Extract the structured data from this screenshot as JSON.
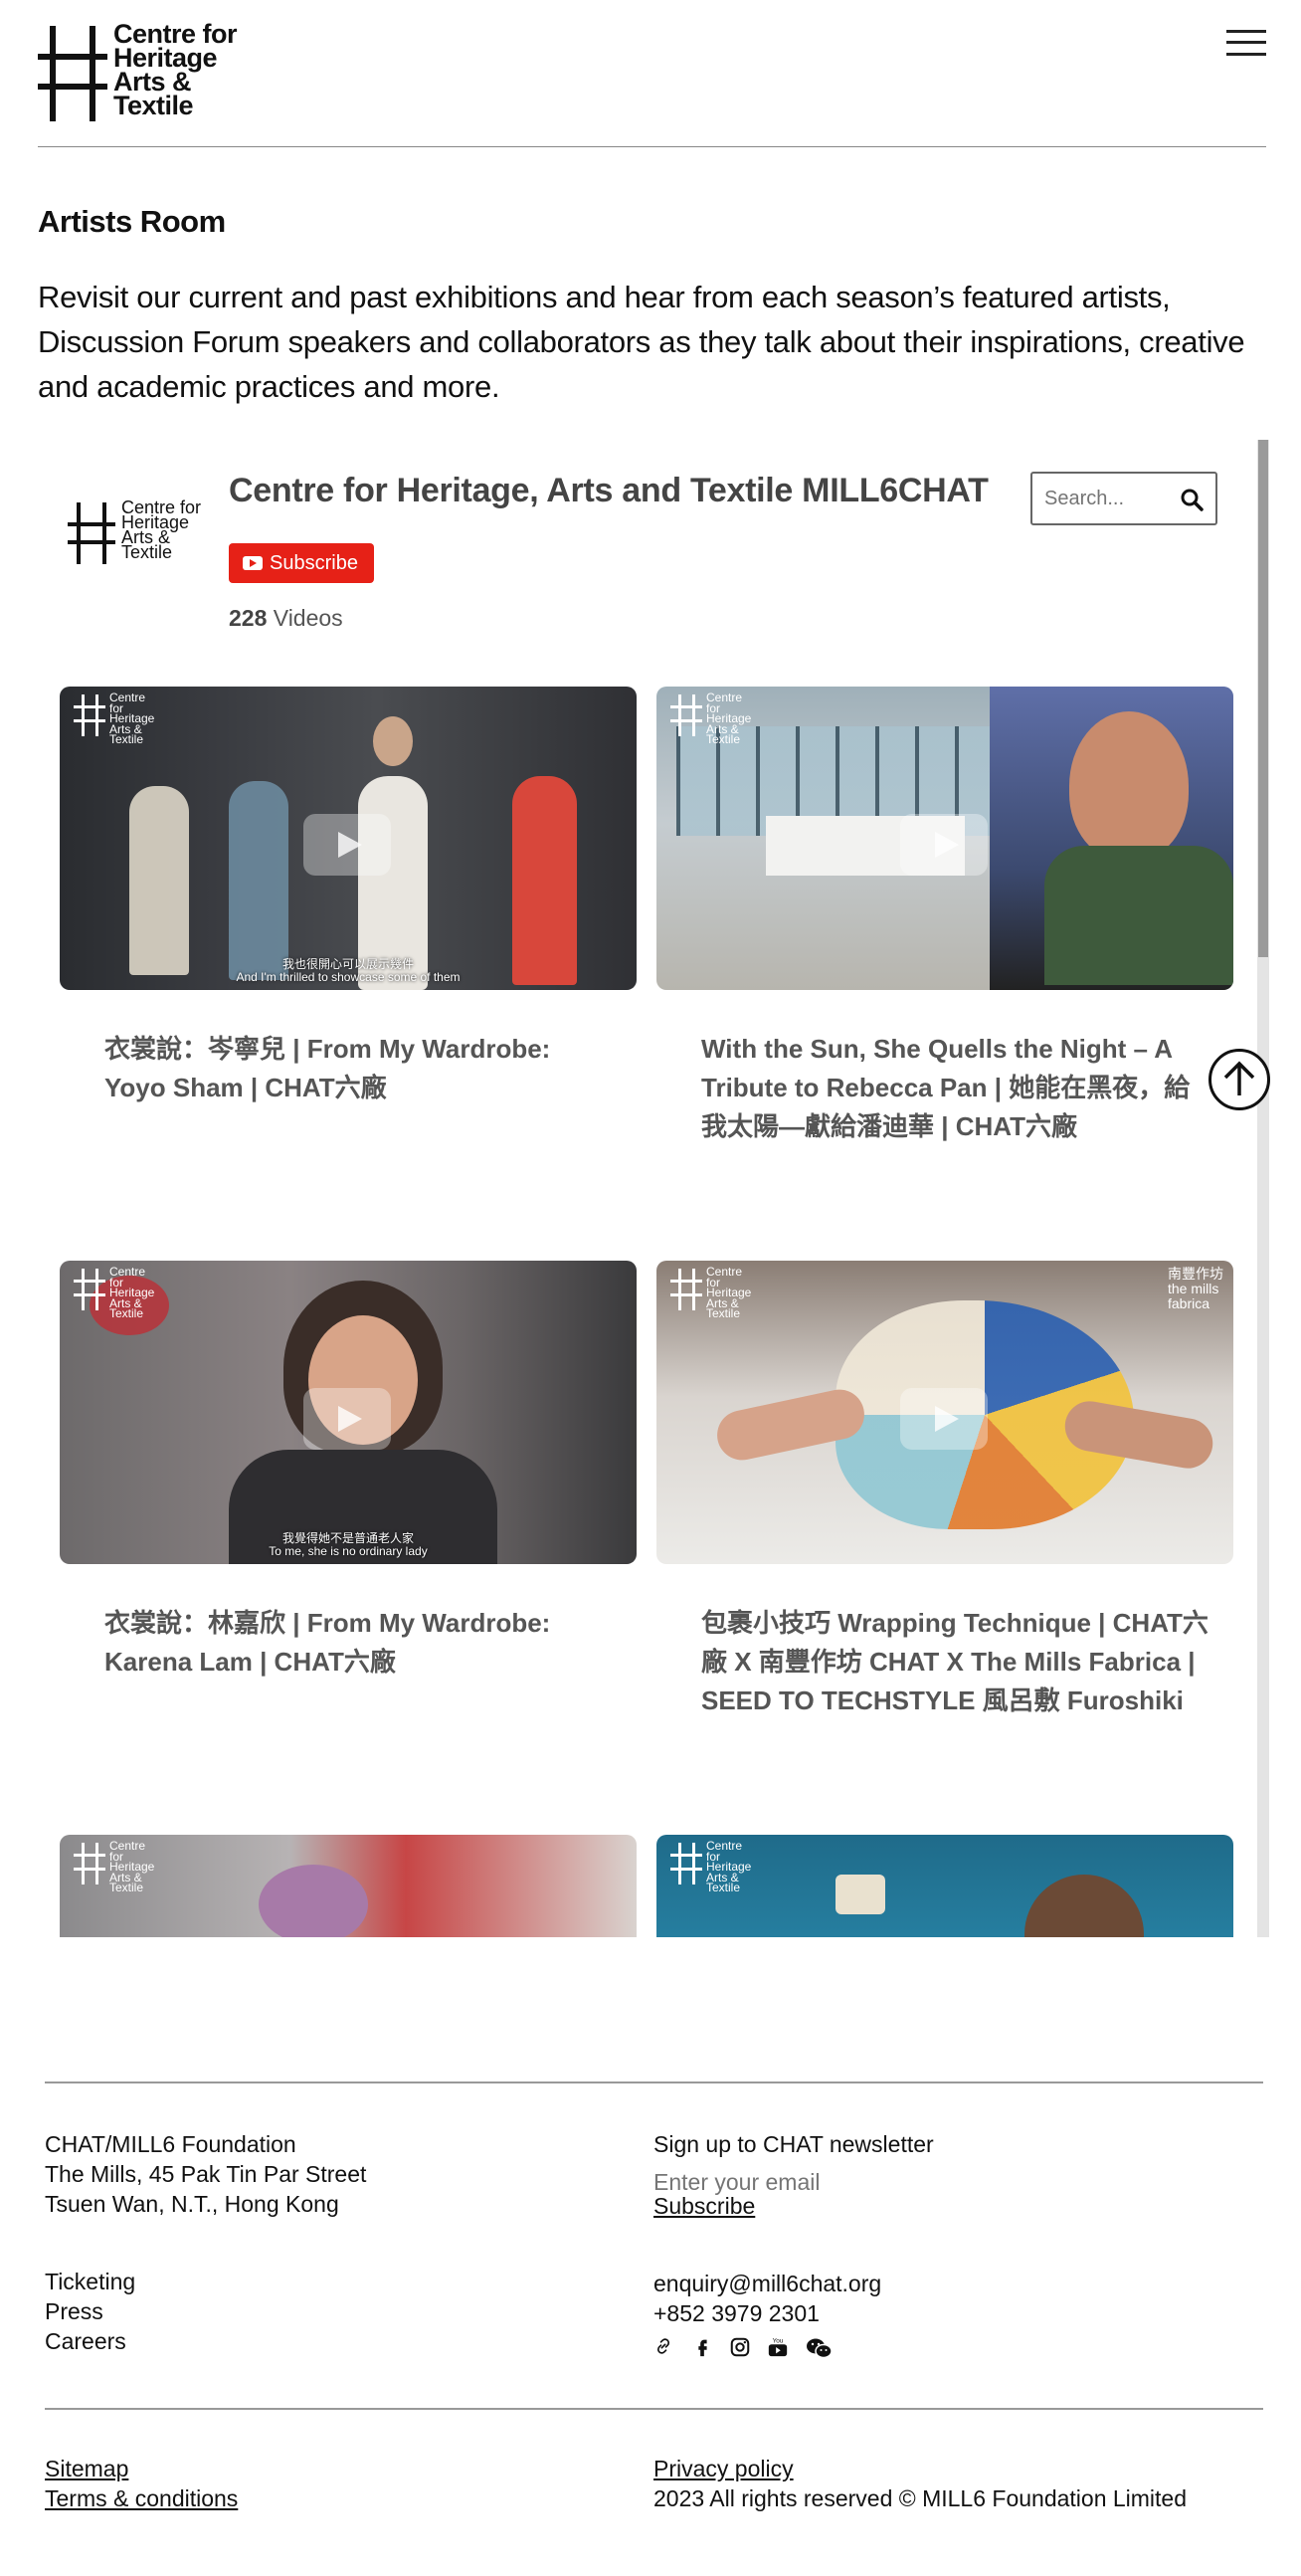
{
  "header": {
    "logo_lines": [
      "Centre for",
      "Heritage",
      "Arts &",
      "Textile"
    ],
    "menu_icon": "hamburger-menu-icon"
  },
  "page": {
    "title": "Artists Room",
    "intro": "Revisit our current and past exhibitions and hear from each season’s featured artists, Discussion Forum speakers and collaborators as they talk about their inspirations, creative and academic practices and more."
  },
  "channel": {
    "logo_lines": [
      "Centre for",
      "Heritage",
      "Arts &",
      "Textile"
    ],
    "name": "Centre for Heritage, Arts and Textile MILL6CHAT",
    "search_placeholder": "Search...",
    "subscribe_label": "Subscribe",
    "video_count": "228",
    "video_count_label": "Videos"
  },
  "thumb_badge_lines": [
    "Centre for",
    "Heritage",
    "Arts &",
    "Textile"
  ],
  "videos": [
    {
      "title": "衣裳說：岑寧兒 | From My Wardrobe: Yoyo Sham | CHAT六廠",
      "subtitle_zh": "我也很開心可以展示幾件",
      "subtitle_en": "And I'm thrilled to showcase some of them"
    },
    {
      "title": "With the Sun, She Quells the Night – A Tribute to Rebecca Pan | 她能在黑夜，給我太陽—獻給潘迪華 | CHAT六廠"
    },
    {
      "title": "衣裳說：林嘉欣 | From My Wardrobe: Karena Lam | CHAT六廠",
      "subtitle_zh": "我覺得她不是普通老人家",
      "subtitle_en": "To me, she is no ordinary lady"
    },
    {
      "title": "包裹小技巧 Wrapping Technique | CHAT六廠 X 南豐作坊 CHAT X The Mills Fabrica | SEED TO TECHSTYLE 風呂敷 Furoshiki",
      "corner_mark": [
        "南豐作坊",
        "the mills",
        "fabrica"
      ]
    },
    {
      "title": ""
    },
    {
      "title": ""
    }
  ],
  "footer": {
    "address": [
      "CHAT/MILL6 Foundation",
      "The Mills, 45 Pak Tin Par Street",
      "Tsuen Wan, N.T., Hong Kong"
    ],
    "links": [
      "Ticketing",
      "Press",
      "Careers"
    ],
    "newsletter_label": "Sign up to CHAT newsletter",
    "email_placeholder": "Enter your email",
    "subscribe_label": "Subscribe",
    "email": "enquiry@mill6chat.org",
    "phone": "+852 3979 2301",
    "social_icons": [
      "link-icon",
      "facebook-icon",
      "instagram-icon",
      "youtube-icon",
      "wechat-icon"
    ],
    "sitemap": "Sitemap",
    "terms": "Terms & conditions",
    "privacy": "Privacy policy",
    "copyright": "2023 All rights reserved © MILL6 Foundation Limited"
  }
}
